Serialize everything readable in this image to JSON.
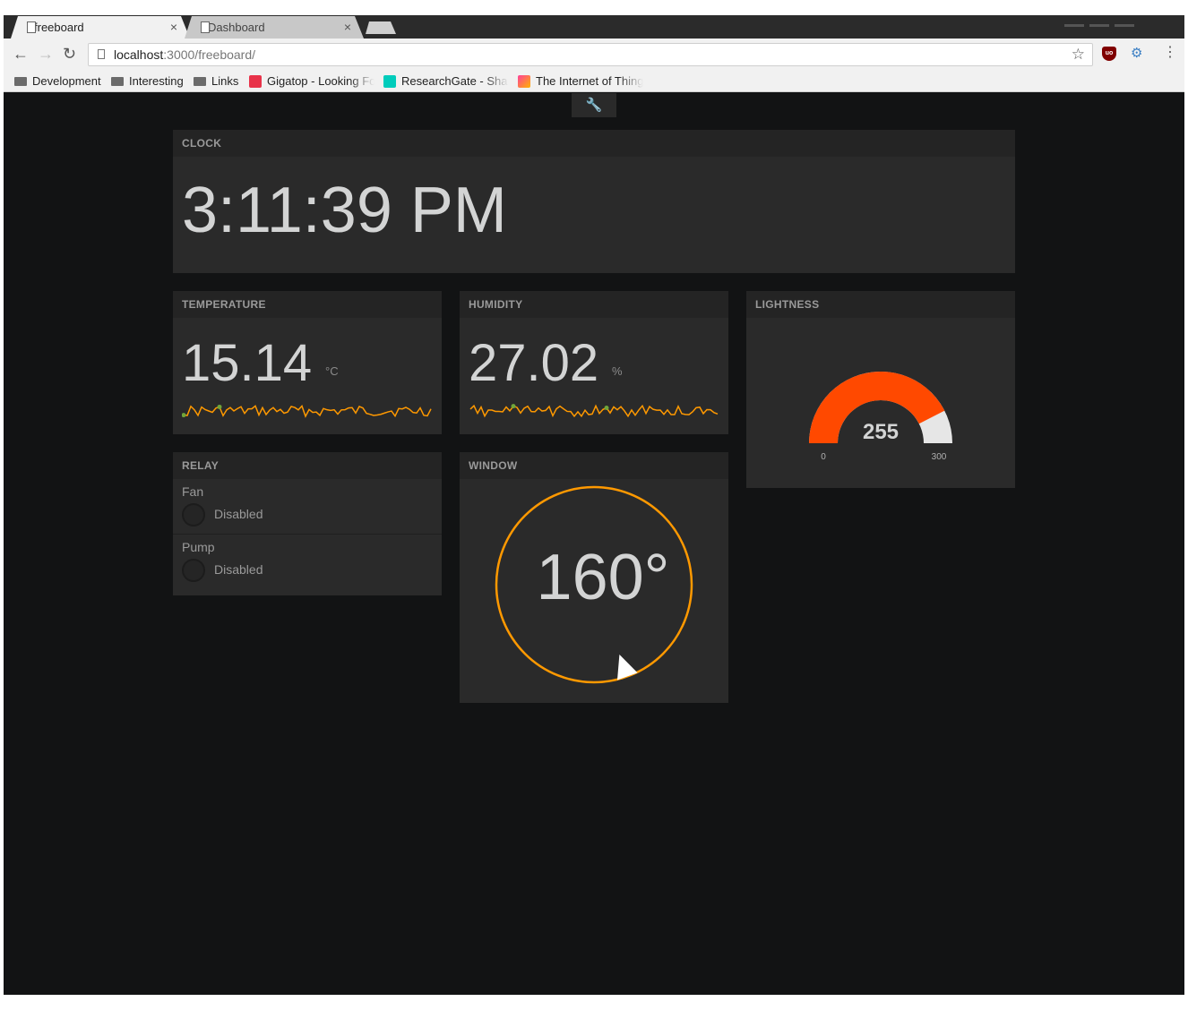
{
  "browser": {
    "tabs": [
      {
        "label": "freeboard",
        "active": true
      },
      {
        "label": "Dashboard",
        "active": false
      }
    ],
    "close_glyph": "×",
    "url_host": "localhost",
    "url_path": ":3000/freeboard/",
    "bookmarks": [
      {
        "label": "Development",
        "icon": "folder-icon"
      },
      {
        "label": "Interesting",
        "icon": "folder-icon"
      },
      {
        "label": "Links",
        "icon": "folder-icon"
      },
      {
        "label": "Gigatop - Looking Fo",
        "icon": "gigatop-icon"
      },
      {
        "label": "ResearchGate - Sha",
        "icon": "researchgate-icon"
      },
      {
        "label": "The Internet of Thing",
        "icon": "iot-icon"
      }
    ]
  },
  "dashboard": {
    "clock": {
      "title": "CLOCK",
      "time": "3:11:39 PM"
    },
    "temperature": {
      "title": "TEMPERATURE",
      "value": "15.14",
      "unit": "°C"
    },
    "humidity": {
      "title": "HUMIDITY",
      "value": "27.02",
      "unit": "%"
    },
    "lightness": {
      "title": "LIGHTNESS",
      "value": "255",
      "min": "0",
      "max": "300",
      "fraction": 0.85
    },
    "relay": {
      "title": "RELAY",
      "items": [
        {
          "name": "Fan",
          "status": "Disabled"
        },
        {
          "name": "Pump",
          "status": "Disabled"
        }
      ]
    },
    "window": {
      "title": "WINDOW",
      "value": "160°",
      "angle_deg": 160
    }
  },
  "colors": {
    "background": "#121314",
    "pane": "#2a2a2a",
    "sparkline": "#ff9900",
    "sparkline_marker": "#6fa53a",
    "gauge_fill": "#ff4900",
    "gauge_track": "#e6e6e6",
    "dial_ring": "#ff9900"
  }
}
